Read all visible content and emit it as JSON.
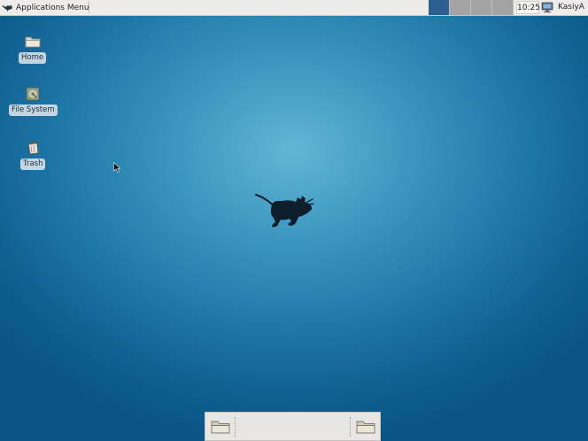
{
  "top_panel": {
    "applications_menu_label": "Applications Menu",
    "clock": "10:25",
    "username": "KasiyA",
    "workspaces": [
      {
        "active": true
      },
      {
        "active": false
      },
      {
        "active": false
      },
      {
        "active": false
      }
    ]
  },
  "desktop": {
    "icons": [
      {
        "label": "Home",
        "icon": "folder-icon"
      },
      {
        "label": "File System",
        "icon": "hard-drive-icon"
      },
      {
        "label": "Trash",
        "icon": "trash-icon"
      }
    ],
    "background_colors": {
      "center": "#62b6d4",
      "edge": "#0b5585"
    }
  },
  "bottom_dock": {
    "launchers": [
      {
        "icon": "folder-icon"
      },
      {
        "icon": "folder-icon"
      }
    ]
  }
}
